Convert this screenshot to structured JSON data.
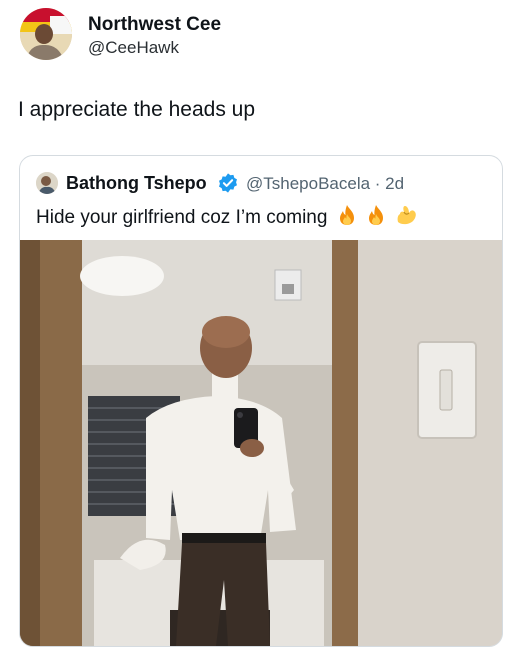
{
  "tweet": {
    "author_name": "Northwest Cee",
    "author_handle": "@CeeHawk",
    "text": "I appreciate the heads up"
  },
  "quoted": {
    "author_name": "Bathong Tshepo",
    "meta": "@TshepoBacela · 2d",
    "text": "Hide your girlfriend coz I’m coming",
    "emojis": [
      "fire-emoji",
      "fire-emoji",
      "pinched-fingers-emoji"
    ]
  },
  "colors": {
    "verified": "#1d9bf0",
    "muted": "#536471",
    "border": "#d5dbe0"
  }
}
